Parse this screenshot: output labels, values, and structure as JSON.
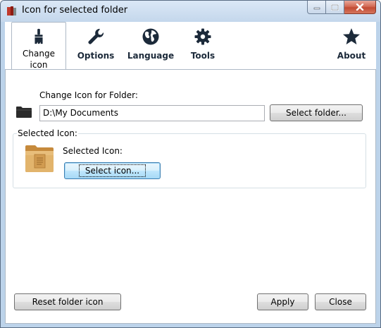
{
  "window": {
    "title": "Icon for selected folder",
    "caption_buttons": [
      "minimize-icon",
      "maximize-icon",
      "close-icon"
    ]
  },
  "toolbar": {
    "items": [
      {
        "label": "Change\nicon",
        "icon": "paintbrush-icon",
        "active": true
      },
      {
        "label": "Options",
        "icon": "wrench-icon",
        "active": false
      },
      {
        "label": "Language",
        "icon": "globe-icon",
        "active": false
      },
      {
        "label": "Tools",
        "icon": "gear-icon",
        "active": false
      },
      {
        "label": "About",
        "icon": "star-icon",
        "active": false
      }
    ]
  },
  "folder_section": {
    "label": "Change Icon for Folder:",
    "path_value": "D:\\My Documents",
    "select_folder_button": "Select folder..."
  },
  "icon_section": {
    "group_title": "Selected Icon:",
    "label": "Selected Icon:",
    "select_icon_button": "Select icon..."
  },
  "footer": {
    "reset_button": "Reset folder icon",
    "apply_button": "Apply",
    "close_button": "Close"
  },
  "colors": {
    "toolbar_icon": "#1c2a3a",
    "folder_icon": "#2b2b2b",
    "preview_folder": "#d9a55c",
    "window_frame": "#bcd3ea"
  }
}
